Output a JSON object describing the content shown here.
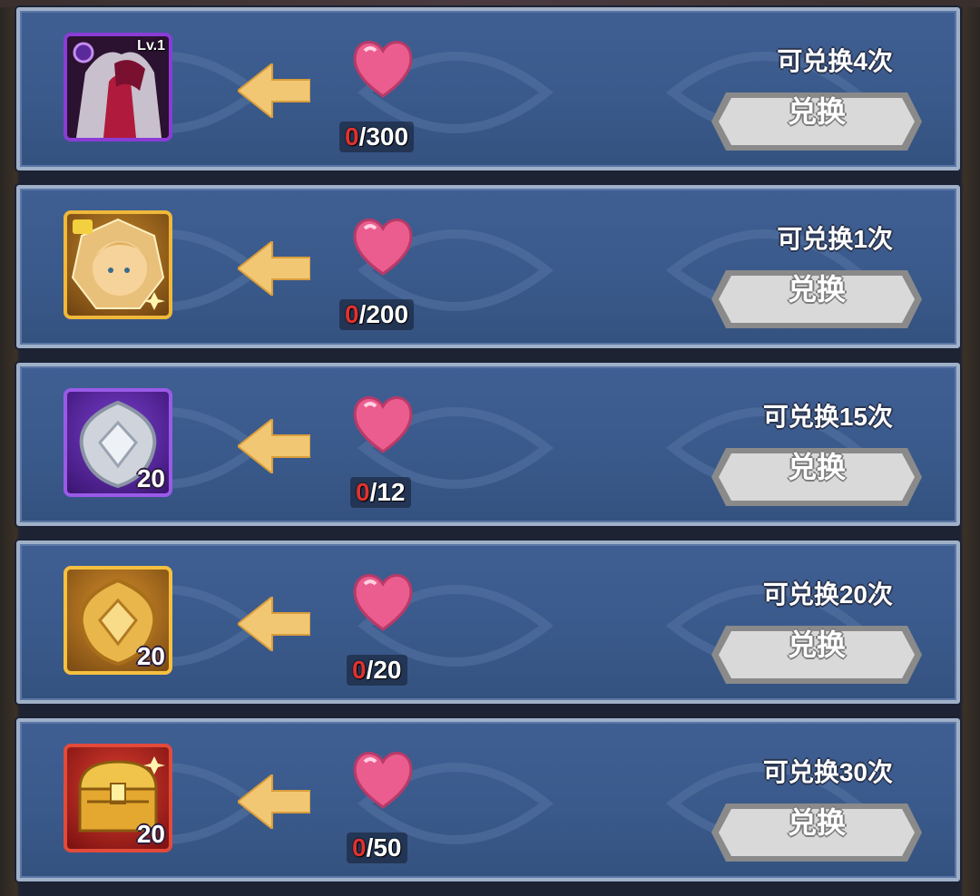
{
  "colors": {
    "panel_blue": "#3a5a8c",
    "panel_border": "#9fb0c8",
    "heart_pink": "#ea5d8e",
    "arrow_gold": "#f1c774",
    "have_red": "#e0322e",
    "button_grey": "#d9d9d9"
  },
  "rows": [
    {
      "item_icon": "hero-card-icon",
      "frame": "purple",
      "badge": "Lv.1",
      "quantity": "",
      "cost_icon": "heart-icon",
      "have": "0",
      "cost": "/300",
      "limit_label": "可兑换4次",
      "button_label": "兑换"
    },
    {
      "item_icon": "skin-portrait-icon",
      "frame": "gold",
      "badge": "",
      "quantity": "",
      "cost_icon": "heart-icon",
      "have": "0",
      "cost": "/200",
      "limit_label": "可兑换1次",
      "button_label": "兑换"
    },
    {
      "item_icon": "silver-crystal-icon",
      "frame": "purple2",
      "badge": "",
      "quantity": "20",
      "cost_icon": "heart-icon",
      "have": "0",
      "cost": "/12",
      "limit_label": "可兑换15次",
      "button_label": "兑换"
    },
    {
      "item_icon": "gold-crystal-icon",
      "frame": "gold2",
      "badge": "",
      "quantity": "20",
      "cost_icon": "heart-icon",
      "have": "0",
      "cost": "/20",
      "limit_label": "可兑换20次",
      "button_label": "兑换"
    },
    {
      "item_icon": "treasure-chest-icon",
      "frame": "red",
      "badge": "",
      "quantity": "20",
      "cost_icon": "heart-icon",
      "have": "0",
      "cost": "/50",
      "limit_label": "可兑换30次",
      "button_label": "兑换"
    }
  ]
}
